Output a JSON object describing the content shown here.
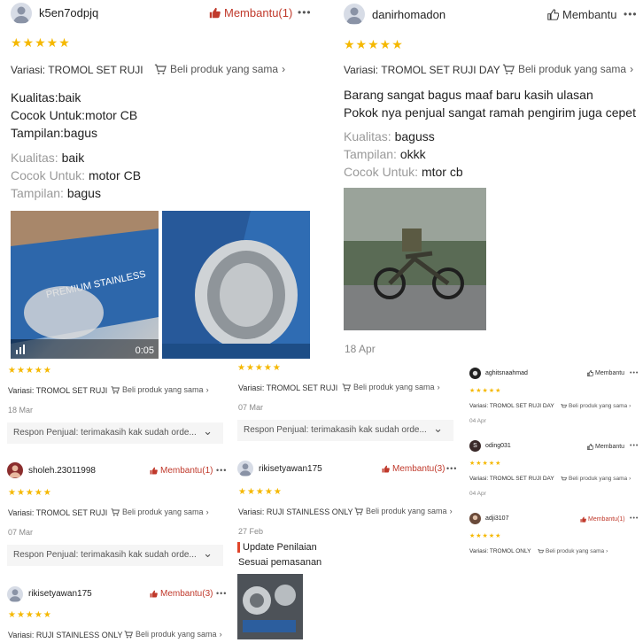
{
  "r1": {
    "username": "k5en7odpjq",
    "helpful": "Membantu(1)",
    "stars": "★★★★★",
    "variation": "Variasi: TROMOL SET RUJI",
    "buy_same": "Beli produk yang sama",
    "lines": [
      "Kualitas:baik",
      "Cocok Untuk:motor CB",
      "Tampilan:bagus"
    ],
    "attrs": [
      {
        "label": "Kualitas:",
        "value": "baik"
      },
      {
        "label": "Cocok Untuk:",
        "value": "motor CB"
      },
      {
        "label": "Tampilan:",
        "value": "bagus"
      }
    ],
    "video_duration": "0:05"
  },
  "r2": {
    "username": "danirhomadon",
    "helpful": "Membantu",
    "stars": "★★★★★",
    "variation": "Variasi: TROMOL SET RUJI DAY",
    "buy_same": "Beli produk yang sama",
    "lines": [
      "Barang sangat bagus maaf baru kasih ulasan",
      "Pokok nya penjual sangat ramah pengirim juga cepet"
    ],
    "attrs": [
      {
        "label": "Kualitas:",
        "value": "baguss"
      },
      {
        "label": "Tampilan:",
        "value": "okkk"
      },
      {
        "label": "Cocok Untuk:",
        "value": "mtor cb"
      }
    ],
    "date": "18 Apr"
  },
  "s1": {
    "stars": "★★★★★",
    "variation": "Variasi: TROMOL SET RUJI",
    "buy_same": "Beli produk yang sama",
    "date": "18 Mar",
    "seller_reply": "Respon Penjual: terimakasih kak sudah orde..."
  },
  "s2": {
    "stars": "★★★★★",
    "variation": "Variasi: TROMOL SET RUJI",
    "buy_same": "Beli produk yang sama",
    "date": "07 Mar",
    "seller_reply": "Respon Penjual: terimakasih kak sudah orde..."
  },
  "s3": {
    "username": "sholeh.23011998",
    "helpful": "Membantu(1)",
    "stars": "★★★★★",
    "variation": "Variasi: TROMOL SET RUJI",
    "buy_same": "Beli produk yang sama",
    "date": "07 Mar",
    "seller_reply": "Respon Penjual: terimakasih kak sudah orde..."
  },
  "s4": {
    "username": "rikisetyawan175",
    "helpful": "Membantu(3)",
    "stars": "★★★★★",
    "variation": "Variasi: RUJI STAINLESS ONLY",
    "buy_same": "Beli produk yang sama",
    "date": "27 Feb",
    "update_label": "Update Penilaian",
    "update_text": "Sesuai pemasanan"
  },
  "s5": {
    "username": "rikisetyawan175",
    "helpful": "Membantu(3)",
    "stars": "★★★★★",
    "variation": "Variasi: RUJI STAINLESS ONLY",
    "buy_same": "Beli produk yang sama"
  },
  "t1": {
    "username": "aghitsnaahmad",
    "helpful": "Membantu",
    "stars": "★★★★★",
    "variation": "Variasi: TROMOL SET RUJI DAY",
    "buy_same": "Beli produk yang sama",
    "date": "04 Apr"
  },
  "t2": {
    "username": "oding031",
    "helpful": "Membantu",
    "stars": "★★★★★",
    "variation": "Variasi: TROMOL SET RUJI DAY",
    "buy_same": "Beli produk yang sama",
    "date": "04 Apr"
  },
  "t3": {
    "username": "adji3107",
    "helpful": "Membantu(1)",
    "stars": "★★★★★",
    "variation": "Variasi: TROMOL ONLY",
    "buy_same": "Beli produk yang sama"
  },
  "ui": {
    "more": "•••",
    "chevron": "›",
    "dropdown": "⌄"
  },
  "colors": {
    "star": "#f5b800",
    "helpful_active": "#c0392b",
    "text": "#222222",
    "muted": "#9a9a9a"
  }
}
